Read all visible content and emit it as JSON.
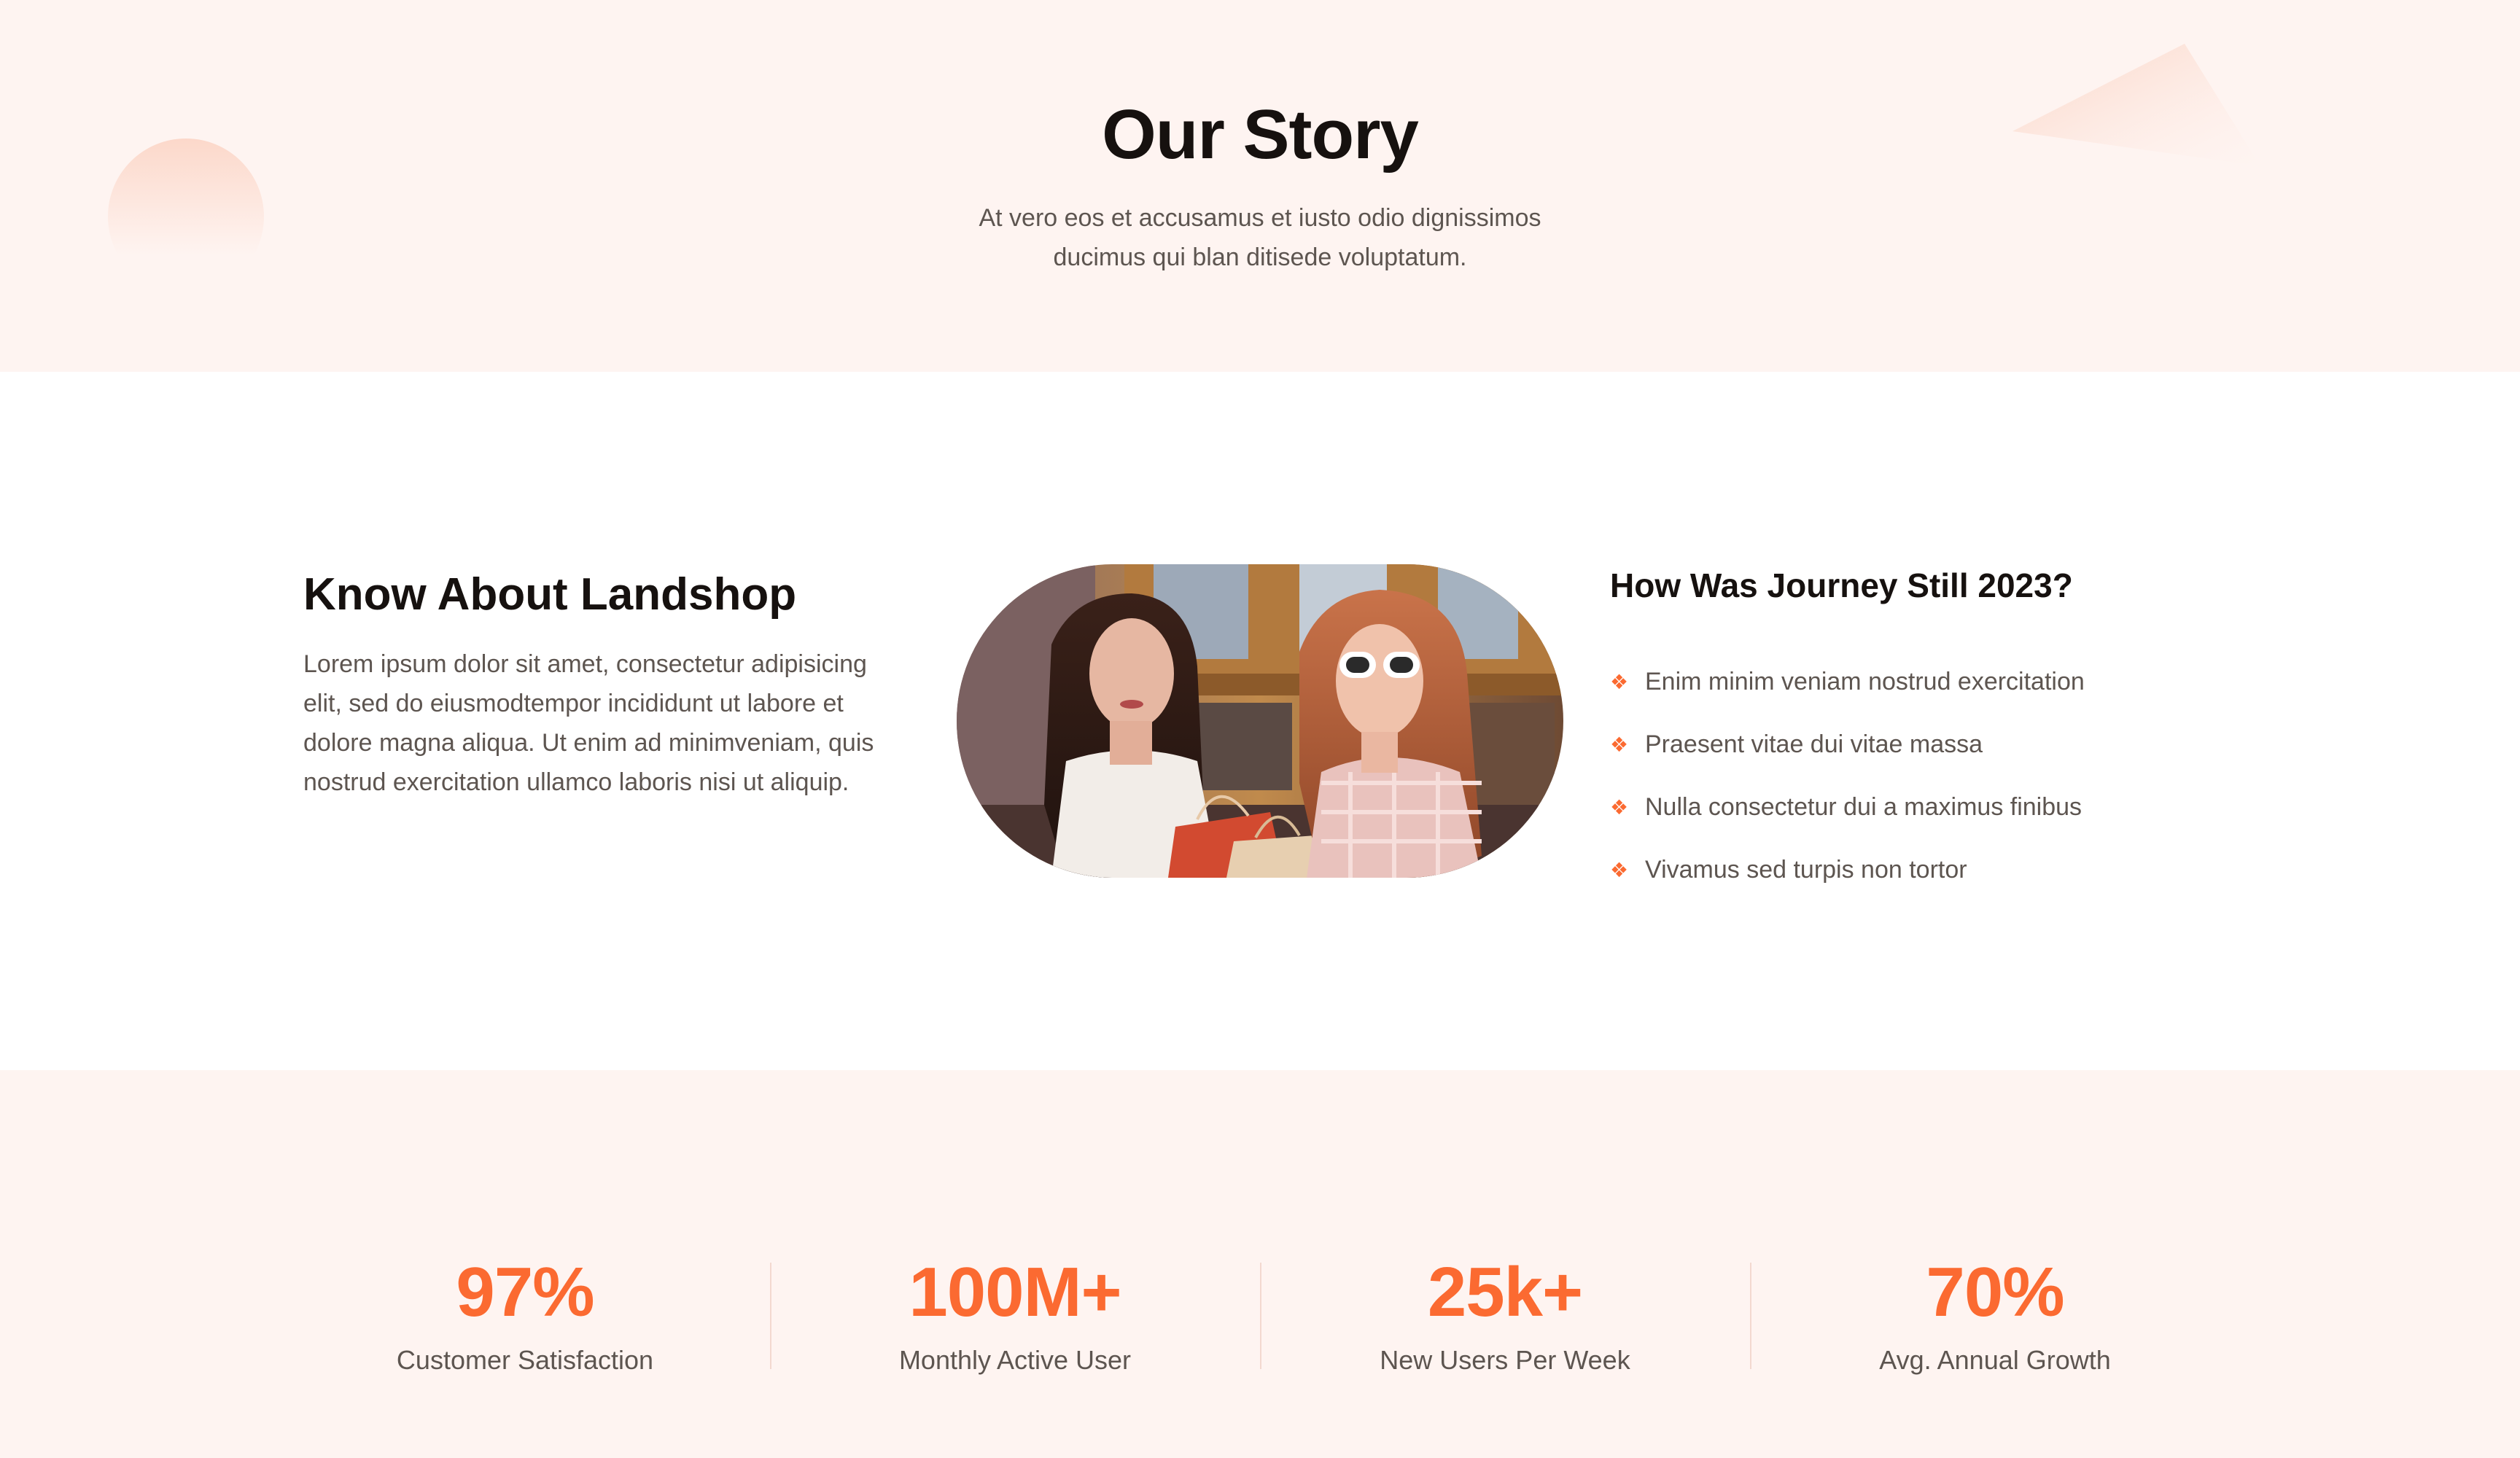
{
  "hero": {
    "title": "Our Story",
    "subtitle": "At vero eos et accusamus et iusto odio dignissimos ducimus qui blan ditisede voluptatum."
  },
  "about": {
    "title": "Know About Landshop",
    "text": "Lorem ipsum dolor sit amet, consectetur adipisicing elit, sed do eiusmodtempor incididunt ut labore et dolore magna aliqua. Ut enim ad minimveniam, quis nostrud exercitation ullamco laboris nisi ut aliquip."
  },
  "journey": {
    "title": "How Was Journey Still 2023?",
    "bullet_icon": "diamond-bullet-icon",
    "items": [
      {
        "label": "Enim minim veniam nostrud exercitation"
      },
      {
        "label": "Praesent vitae dui vitae massa"
      },
      {
        "label": "Nulla consectetur dui a maximus finibus"
      },
      {
        "label": "Vivamus sed turpis non tortor"
      }
    ]
  },
  "stats": [
    {
      "value": "97%",
      "label": "Customer Satisfaction"
    },
    {
      "value": "100M+",
      "label": "Monthly Active User"
    },
    {
      "value": "25k+",
      "label": "New Users Per Week"
    },
    {
      "value": "70%",
      "label": "Avg. Annual Growth"
    }
  ],
  "colors": {
    "accent": "#fb6a31",
    "section_bg": "#fef4f1",
    "heading": "#16110f",
    "body_text": "#5d5550"
  }
}
